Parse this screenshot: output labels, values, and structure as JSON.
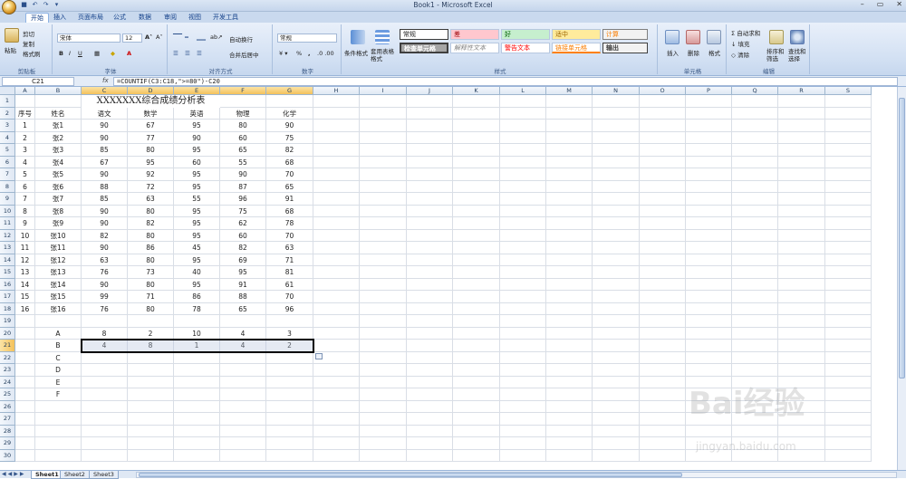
{
  "window": {
    "title": "Book1 - Microsoft Excel",
    "controls": [
      "–",
      "▭",
      "✕"
    ]
  },
  "tabs": [
    "开始",
    "插入",
    "页面布局",
    "公式",
    "数据",
    "审阅",
    "视图",
    "开发工具"
  ],
  "ribbon": {
    "clipboard": {
      "paste": "粘贴",
      "cut": "剪切",
      "copy": "复制",
      "format_painter": "格式刷",
      "label": "剪贴板"
    },
    "font": {
      "name": "宋体",
      "size": "12",
      "label": "字体"
    },
    "alignment": {
      "wrap": "自动换行",
      "merge": "合并后居中",
      "label": "对齐方式"
    },
    "number": {
      "format": "常规",
      "label": "数字"
    },
    "styles": {
      "cond_format": "条件格式",
      "table_format": "套用表格格式",
      "cells": [
        "常规",
        "差",
        "好",
        "适中",
        "计算",
        "检查单元格",
        "解释性文本",
        "警告文本",
        "链接单元格",
        "输出"
      ],
      "label": "样式"
    },
    "cells_group": {
      "insert": "插入",
      "delete": "删除",
      "format": "格式",
      "label": "单元格"
    },
    "editing": {
      "autosum": "自动求和",
      "fill": "填充",
      "clear": "清除",
      "sort": "排序和筛选",
      "find": "查找和选择",
      "label": "编辑"
    }
  },
  "formula_bar": {
    "name_box": "C21",
    "fx": "fx",
    "formula": "=COUNTIF(C3:C18,\">=80\")-C20"
  },
  "columns": [
    "A",
    "B",
    "C",
    "D",
    "E",
    "F",
    "G",
    "H",
    "I",
    "J",
    "K",
    "L",
    "M",
    "N",
    "O",
    "P",
    "Q",
    "R",
    "S"
  ],
  "rows": [
    "1",
    "2",
    "3",
    "4",
    "5",
    "6",
    "7",
    "8",
    "9",
    "10",
    "11",
    "12",
    "13",
    "14",
    "15",
    "16",
    "17",
    "18",
    "19",
    "20",
    "21",
    "22",
    "23",
    "24",
    "25",
    "26",
    "27",
    "28",
    "29",
    "30"
  ],
  "sheet": {
    "title": "XXXXXXX综合成绩分析表",
    "headers": [
      "序号",
      "姓名",
      "语文",
      "数学",
      "英语",
      "物理",
      "化学"
    ],
    "records": [
      [
        "1",
        "张1",
        "90",
        "67",
        "95",
        "80",
        "90"
      ],
      [
        "2",
        "张2",
        "90",
        "77",
        "90",
        "60",
        "75"
      ],
      [
        "3",
        "张3",
        "85",
        "80",
        "95",
        "65",
        "82"
      ],
      [
        "4",
        "张4",
        "67",
        "95",
        "60",
        "55",
        "68"
      ],
      [
        "5",
        "张5",
        "90",
        "92",
        "95",
        "90",
        "70"
      ],
      [
        "6",
        "张6",
        "88",
        "72",
        "95",
        "87",
        "65"
      ],
      [
        "7",
        "张7",
        "85",
        "63",
        "55",
        "96",
        "91"
      ],
      [
        "8",
        "张8",
        "90",
        "80",
        "95",
        "75",
        "68"
      ],
      [
        "9",
        "张9",
        "90",
        "82",
        "95",
        "62",
        "78"
      ],
      [
        "10",
        "张10",
        "82",
        "80",
        "95",
        "60",
        "70"
      ],
      [
        "11",
        "张11",
        "90",
        "86",
        "45",
        "82",
        "63"
      ],
      [
        "12",
        "张12",
        "63",
        "80",
        "95",
        "69",
        "71"
      ],
      [
        "13",
        "张13",
        "76",
        "73",
        "40",
        "95",
        "81"
      ],
      [
        "14",
        "张14",
        "90",
        "80",
        "95",
        "91",
        "61"
      ],
      [
        "15",
        "张15",
        "99",
        "71",
        "86",
        "88",
        "70"
      ],
      [
        "16",
        "张16",
        "76",
        "80",
        "78",
        "65",
        "96"
      ]
    ],
    "summary": [
      [
        "A",
        "8",
        "2",
        "10",
        "4",
        "3"
      ],
      [
        "B",
        "4",
        "8",
        "1",
        "4",
        "2"
      ],
      [
        "C",
        "",
        "",
        "",
        "",
        ""
      ],
      [
        "D",
        "",
        "",
        "",
        "",
        ""
      ],
      [
        "E",
        "",
        "",
        "",
        "",
        ""
      ],
      [
        "F",
        "",
        "",
        "",
        "",
        ""
      ]
    ]
  },
  "sheet_tabs": [
    "Sheet1",
    "Sheet2",
    "Sheet3"
  ],
  "watermark": {
    "brand": "Bai经验",
    "url": "jingyan.baidu.com"
  },
  "colors": {
    "ribbon": "#d2e0f3",
    "selected_header": "#f4c25b",
    "tab_text": "#15428b"
  }
}
